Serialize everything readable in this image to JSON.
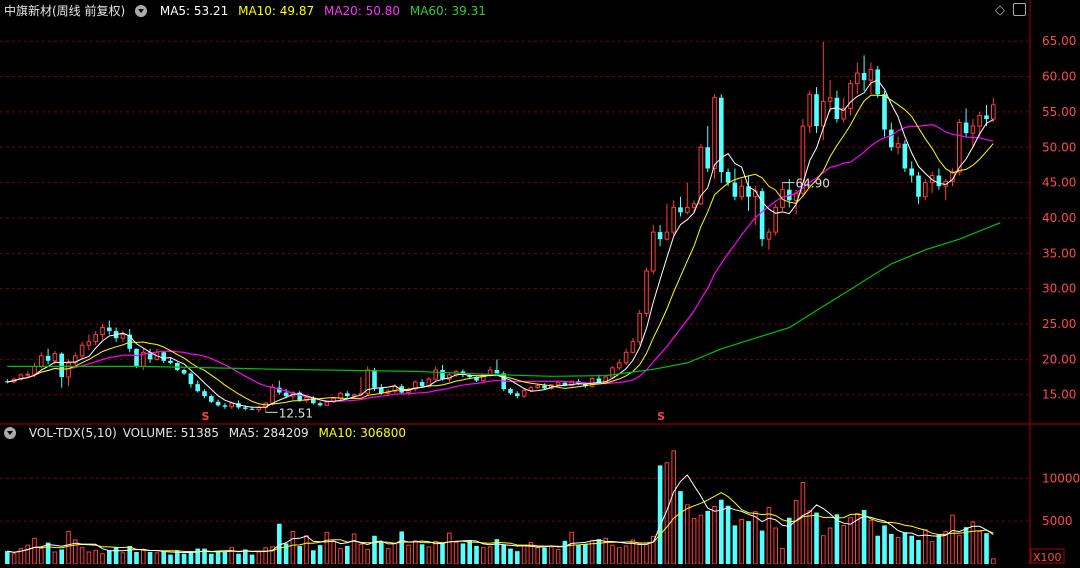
{
  "price_header": {
    "title": "中旗新材(周线 前复权)",
    "ma5_label": "MA5: 53.21",
    "ma10_label": "MA10: 49.87",
    "ma20_label": "MA20: 50.80",
    "ma60_label": "MA60: 39.31"
  },
  "volume_header": {
    "title": "VOL-TDX(5,10)",
    "volume_label": "VOLUME: 51385",
    "ma5_label": "MA5: 284209",
    "ma10_label": "MA10: 306800"
  },
  "icons": {
    "dropdown": "chevron-down-icon",
    "diamond": "diamond-icon",
    "panel": "panel-toggle-icon"
  },
  "colors": {
    "background": "#000000",
    "up": "#ff3b3b",
    "down": "#54ffff",
    "ma5": "#ffffff",
    "ma10": "#ffff00",
    "ma20": "#ff00ff",
    "ma60": "#00c000",
    "grid": "#7a0000",
    "axis_text": "#ff4a4a"
  },
  "chart_data": [
    {
      "type": "candlestick",
      "title": "中旗新材(周线 前复权)",
      "y_ticks": [
        "15.00",
        "20.00",
        "25.00",
        "30.00",
        "35.00",
        "40.00",
        "45.00",
        "50.00",
        "55.00",
        "60.00",
        "65.00"
      ],
      "ylim": [
        11,
        68
      ],
      "grid": "dashed horizontal",
      "annotations": [
        {
          "text": "64.90",
          "type": "high",
          "candle": 114
        },
        {
          "text": "12.51",
          "type": "low",
          "candle": 38
        },
        {
          "text": "S",
          "type": "marker",
          "candle": 29
        },
        {
          "text": "S",
          "type": "marker",
          "candle": 96
        }
      ],
      "candles": [
        [
          16.9,
          17.2,
          16.6,
          16.8
        ],
        [
          16.8,
          17.4,
          16.6,
          17.2
        ],
        [
          17.2,
          18.0,
          17.0,
          17.8
        ],
        [
          17.8,
          18.3,
          17.5,
          17.9
        ],
        [
          17.9,
          19.5,
          17.5,
          19.0
        ],
        [
          19.0,
          21.0,
          18.7,
          20.5
        ],
        [
          20.5,
          21.5,
          19.3,
          19.8
        ],
        [
          19.8,
          21.2,
          19.3,
          20.8
        ],
        [
          20.8,
          21.0,
          16.0,
          17.5
        ],
        [
          17.5,
          20.0,
          16.2,
          19.5
        ],
        [
          19.5,
          21.0,
          19.0,
          20.5
        ],
        [
          20.5,
          22.5,
          20.0,
          22.0
        ],
        [
          22.0,
          23.5,
          21.3,
          22.5
        ],
        [
          22.5,
          24.0,
          22.0,
          23.5
        ],
        [
          23.5,
          25.0,
          22.8,
          24.5
        ],
        [
          24.5,
          25.5,
          23.5,
          24.0
        ],
        [
          24.0,
          24.5,
          22.5,
          23.0
        ],
        [
          23.0,
          24.0,
          22.5,
          23.5
        ],
        [
          23.5,
          24.3,
          21.0,
          21.5
        ],
        [
          21.5,
          21.5,
          18.8,
          19.0
        ],
        [
          19.0,
          21.5,
          18.5,
          21.0
        ],
        [
          21.0,
          21.5,
          19.5,
          20.0
        ],
        [
          20.0,
          21.5,
          19.8,
          21.0
        ],
        [
          21.0,
          21.2,
          19.5,
          19.8
        ],
        [
          19.8,
          20.2,
          19.3,
          19.5
        ],
        [
          19.5,
          19.6,
          18.3,
          18.5
        ],
        [
          18.5,
          18.7,
          17.8,
          18.0
        ],
        [
          18.0,
          18.2,
          16.0,
          16.5
        ],
        [
          16.5,
          17.0,
          15.3,
          15.5
        ],
        [
          15.5,
          15.8,
          14.5,
          14.8
        ],
        [
          14.8,
          15.0,
          13.8,
          14.0
        ],
        [
          14.0,
          14.3,
          13.3,
          13.5
        ],
        [
          13.5,
          13.8,
          13.0,
          13.3
        ],
        [
          13.3,
          14.0,
          13.0,
          13.8
        ],
        [
          13.8,
          14.2,
          13.0,
          13.2
        ],
        [
          13.2,
          13.5,
          12.8,
          13.0
        ],
        [
          13.0,
          13.3,
          12.8,
          12.9
        ],
        [
          12.9,
          13.5,
          12.5,
          13.2
        ],
        [
          13.2,
          14.0,
          12.51,
          13.8
        ],
        [
          13.8,
          16.5,
          13.5,
          16.0
        ],
        [
          16.0,
          17.0,
          15.0,
          15.3
        ],
        [
          15.3,
          15.8,
          14.5,
          14.8
        ],
        [
          14.8,
          15.5,
          14.3,
          15.3
        ],
        [
          15.3,
          15.5,
          14.0,
          14.2
        ],
        [
          14.2,
          14.8,
          13.9,
          14.6
        ],
        [
          14.6,
          14.8,
          13.6,
          13.8
        ],
        [
          13.8,
          14.0,
          13.3,
          13.5
        ],
        [
          13.5,
          14.2,
          13.4,
          14.0
        ],
        [
          14.0,
          14.6,
          13.8,
          14.5
        ],
        [
          14.5,
          15.4,
          14.0,
          15.2
        ],
        [
          15.2,
          15.5,
          14.5,
          14.8
        ],
        [
          14.8,
          15.2,
          14.5,
          15.0
        ],
        [
          15.0,
          17.5,
          14.8,
          15.2
        ],
        [
          15.2,
          19.0,
          15.0,
          18.5
        ],
        [
          18.5,
          18.8,
          15.5,
          16.0
        ],
        [
          16.0,
          16.5,
          15.0,
          15.2
        ],
        [
          15.2,
          15.8,
          14.8,
          15.5
        ],
        [
          15.5,
          16.5,
          15.2,
          16.2
        ],
        [
          16.2,
          16.5,
          15.0,
          15.3
        ],
        [
          15.3,
          16.0,
          15.0,
          15.8
        ],
        [
          15.8,
          17.0,
          15.5,
          16.8
        ],
        [
          16.8,
          17.2,
          16.0,
          16.2
        ],
        [
          16.2,
          17.5,
          16.0,
          17.2
        ],
        [
          17.2,
          19.0,
          17.0,
          18.5
        ],
        [
          18.5,
          19.2,
          17.0,
          17.2
        ],
        [
          17.2,
          18.0,
          16.8,
          17.8
        ],
        [
          17.8,
          18.5,
          17.5,
          18.3
        ],
        [
          18.3,
          18.6,
          17.5,
          17.8
        ],
        [
          17.8,
          18.0,
          17.2,
          17.5
        ],
        [
          17.5,
          17.6,
          16.8,
          17.0
        ],
        [
          17.0,
          18.0,
          16.8,
          17.8
        ],
        [
          17.8,
          19.0,
          17.5,
          18.5
        ],
        [
          18.5,
          20.0,
          18.2,
          18.0
        ],
        [
          18.0,
          18.3,
          15.5,
          15.8
        ],
        [
          15.8,
          16.0,
          15.0,
          15.2
        ],
        [
          15.2,
          15.5,
          14.5,
          14.8
        ],
        [
          14.8,
          15.8,
          14.6,
          15.6
        ],
        [
          15.6,
          16.3,
          15.4,
          16.0
        ],
        [
          16.0,
          16.5,
          15.8,
          16.3
        ],
        [
          16.3,
          16.6,
          15.8,
          15.9
        ],
        [
          15.9,
          16.5,
          15.7,
          16.4
        ],
        [
          16.4,
          16.9,
          16.2,
          16.7
        ],
        [
          16.7,
          16.8,
          16.2,
          16.3
        ],
        [
          16.3,
          17.0,
          16.2,
          16.9
        ],
        [
          16.9,
          17.2,
          16.4,
          16.5
        ],
        [
          16.5,
          16.8,
          16.0,
          16.2
        ],
        [
          16.2,
          17.5,
          16.0,
          17.3
        ],
        [
          17.3,
          17.8,
          16.6,
          16.7
        ],
        [
          16.7,
          17.6,
          16.5,
          17.5
        ],
        [
          17.5,
          19.0,
          17.3,
          18.8
        ],
        [
          18.8,
          20.0,
          18.5,
          19.5
        ],
        [
          19.5,
          21.5,
          19.2,
          21.0
        ],
        [
          21.0,
          23.0,
          20.8,
          22.5
        ],
        [
          22.5,
          27.0,
          22.0,
          26.5
        ],
        [
          26.5,
          33.0,
          26.0,
          32.5
        ],
        [
          32.5,
          39.0,
          32.0,
          38.0
        ],
        [
          38.0,
          39.0,
          36.0,
          37.0
        ],
        [
          37.0,
          42.0,
          36.8,
          38.0
        ],
        [
          38.0,
          42.5,
          37.5,
          41.5
        ],
        [
          41.5,
          43.0,
          40.2,
          40.8
        ],
        [
          40.8,
          45.0,
          40.5,
          41.5
        ],
        [
          41.5,
          42.5,
          40.8,
          42.0
        ],
        [
          42.0,
          50.5,
          41.8,
          50.0
        ],
        [
          50.0,
          53.0,
          46.5,
          47.0
        ],
        [
          47.0,
          57.5,
          45.5,
          57.0
        ],
        [
          57.0,
          57.5,
          45.0,
          46.5
        ],
        [
          46.5,
          47.0,
          44.5,
          45.0
        ],
        [
          45.0,
          47.0,
          42.5,
          43.0
        ],
        [
          43.0,
          45.5,
          42.5,
          44.5
        ],
        [
          44.5,
          46.0,
          41.0,
          43.0
        ],
        [
          43.0,
          44.5,
          39.0,
          43.8
        ],
        [
          43.8,
          44.2,
          36.0,
          37.0
        ],
        [
          37.0,
          38.5,
          35.5,
          38.0
        ],
        [
          38.0,
          42.0,
          37.5,
          41.5
        ],
        [
          41.5,
          45.0,
          41.0,
          44.0
        ],
        [
          44.0,
          45.5,
          41.5,
          42.5
        ],
        [
          42.5,
          44.0,
          40.5,
          43.5
        ],
        [
          43.5,
          54.0,
          43.0,
          53.0
        ],
        [
          53.0,
          58.0,
          52.0,
          57.5
        ],
        [
          57.5,
          58.5,
          52.0,
          53.0
        ],
        [
          53.0,
          64.9,
          51.0,
          56.5
        ],
        [
          56.5,
          59.5,
          55.0,
          57.0
        ],
        [
          57.0,
          58.0,
          53.5,
          54.0
        ],
        [
          54.0,
          57.0,
          53.5,
          55.5
        ],
        [
          55.5,
          59.5,
          54.5,
          59.0
        ],
        [
          59.0,
          62.0,
          57.5,
          60.5
        ],
        [
          60.5,
          63.0,
          58.0,
          59.5
        ],
        [
          59.5,
          62.0,
          57.5,
          61.0
        ],
        [
          61.0,
          61.5,
          57.0,
          57.5
        ],
        [
          57.5,
          58.0,
          51.5,
          52.5
        ],
        [
          52.5,
          53.5,
          49.5,
          50.0
        ],
        [
          50.0,
          51.5,
          49.0,
          50.5
        ],
        [
          50.5,
          51.0,
          46.5,
          47.0
        ],
        [
          47.0,
          48.0,
          45.0,
          46.0
        ],
        [
          46.0,
          46.5,
          42.0,
          43.0
        ],
        [
          43.0,
          45.5,
          42.5,
          45.0
        ],
        [
          45.0,
          46.5,
          43.5,
          46.0
        ],
        [
          46.0,
          47.0,
          44.0,
          44.5
        ],
        [
          44.5,
          45.5,
          42.5,
          45.2
        ],
        [
          45.2,
          47.0,
          44.5,
          46.5
        ],
        [
          46.5,
          54.0,
          46.0,
          53.5
        ],
        [
          53.5,
          55.5,
          51.5,
          52.0
        ],
        [
          52.0,
          54.0,
          50.0,
          53.0
        ],
        [
          53.0,
          55.0,
          51.5,
          54.5
        ],
        [
          54.5,
          56.0,
          53.0,
          54.0
        ],
        [
          54.0,
          57.0,
          53.5,
          56.0
        ]
      ],
      "ma60": [
        [
          0,
          19.0
        ],
        [
          20,
          19.0
        ],
        [
          40,
          18.6
        ],
        [
          60,
          18.3
        ],
        [
          70,
          17.9
        ],
        [
          80,
          17.6
        ],
        [
          88,
          17.7
        ],
        [
          95,
          18.6
        ],
        [
          100,
          19.5
        ],
        [
          105,
          21.5
        ],
        [
          110,
          23.0
        ],
        [
          115,
          24.5
        ],
        [
          120,
          27.5
        ],
        [
          125,
          30.5
        ],
        [
          130,
          33.5
        ],
        [
          135,
          35.5
        ],
        [
          140,
          37.0
        ],
        [
          146,
          39.31
        ]
      ]
    },
    {
      "type": "bar",
      "title": "VOL-TDX(5,10)",
      "unit": "X100",
      "y_ticks": [
        "5000",
        "10000"
      ],
      "ylim": [
        0,
        14000
      ],
      "values": [
        1500,
        1200,
        1800,
        2200,
        3000,
        1800,
        2500,
        1400,
        1700,
        3800,
        2800,
        1900,
        1400,
        1600,
        1200,
        1600,
        2000,
        1300,
        2100,
        1400,
        1700,
        1400,
        1300,
        1500,
        1100,
        1600,
        1200,
        1300,
        1800,
        1800,
        1200,
        1500,
        1400,
        1900,
        1200,
        1700,
        1100,
        1400,
        1900,
        2000,
        4700,
        2400,
        3800,
        2100,
        3300,
        1600,
        2200,
        3700,
        2600,
        1800,
        2100,
        3500,
        2300,
        1700,
        3300,
        2600,
        1800,
        2400,
        3800,
        2200,
        2700,
        2300,
        2000,
        2600,
        2400,
        3600,
        2500,
        2400,
        2800,
        2100,
        1900,
        2000,
        2900,
        2300,
        1800,
        1500,
        2200,
        2500,
        1900,
        1900,
        2000,
        1700,
        2700,
        3700,
        2200,
        2300,
        2700,
        2900,
        3000,
        2200,
        1900,
        2100,
        2800,
        2400,
        2300,
        3200,
        11500,
        11800,
        13200,
        8500,
        6900,
        5300,
        5700,
        6200,
        6700,
        7500,
        6800,
        4500,
        5200,
        5000,
        6100,
        3900,
        6600,
        4200,
        1800,
        5400,
        7400,
        9500,
        6200,
        6000,
        3300,
        4200,
        5800,
        4500,
        5400,
        5900,
        6300,
        5100,
        3300,
        4500,
        3500,
        3100,
        3700,
        3300,
        2800,
        4000,
        2600,
        3500,
        3800,
        5700,
        3300,
        4300,
        4900,
        3800,
        3600,
        600
      ]
    }
  ]
}
